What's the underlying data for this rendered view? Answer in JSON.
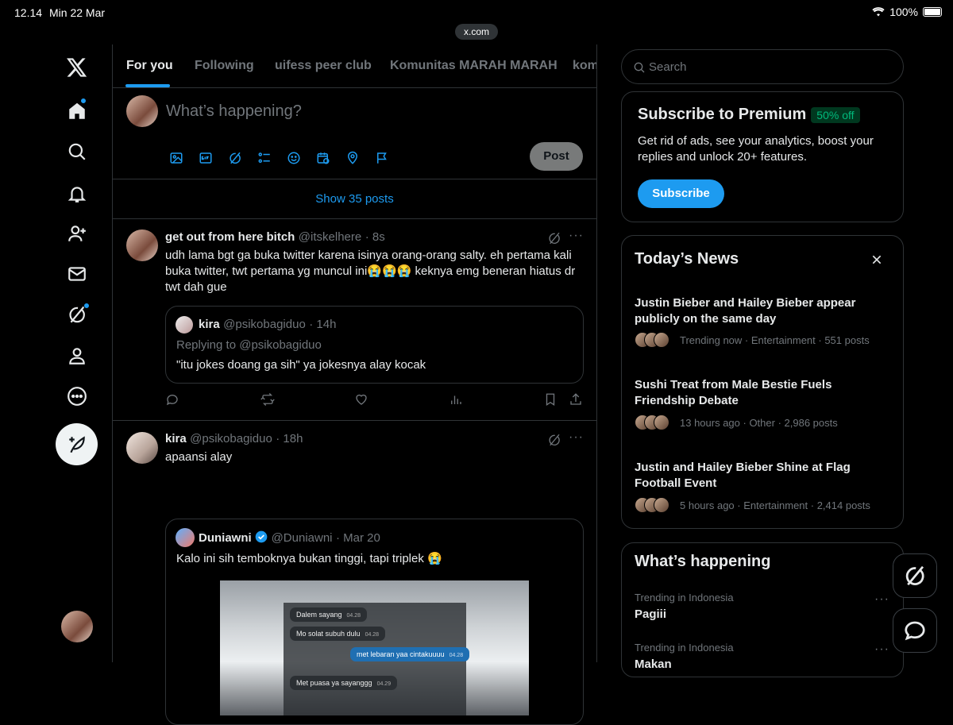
{
  "status_bar": {
    "time": "12.14",
    "date": "Min 22 Mar",
    "battery": "100%"
  },
  "browser": {
    "url": "x.com"
  },
  "tabs": [
    "For you",
    "Following",
    "uifess peer club",
    "Komunitas MARAH MARAH",
    "kom"
  ],
  "composer": {
    "placeholder": "What’s happening?",
    "post_label": "Post"
  },
  "show_posts": "Show 35 posts",
  "tweets": [
    {
      "name": "get out from here bitch",
      "handle": "@itskelhere",
      "time": "· 8s",
      "text": "udh lama bgt ga buka twitter karena isinya orang-orang salty. eh pertama kali buka twitter, twt pertama  yg  muncul ini😭😭😭 keknya  emg  beneran hiatus  dr  twt  dah  gue",
      "quote": {
        "name": "kira",
        "handle": "@psikobagiduo",
        "time": "· 14h",
        "reply_to": "Replying to @psikobagiduo",
        "text": "\"itu jokes doang ga sih\" ya jokesnya alay kocak"
      }
    },
    {
      "name": "kira",
      "handle": "@psikobagiduo",
      "time": "· 18h",
      "text": "apaansi alay",
      "quote": {
        "name": "Duniawni",
        "handle": "@Duniawni",
        "time": "· Mar 20",
        "text": "Kalo ini sih temboknya bukan tinggi, tapi triplek 😭",
        "chat": [
          {
            "text": "Dalem sayang",
            "time": "04.28"
          },
          {
            "text": "Mo solat subuh dulu",
            "time": "04.28"
          },
          {
            "text": "met lebaran yaa cintakuuuu",
            "time": "04.28"
          },
          {
            "text": "Met puasa ya sayanggg",
            "time": "04.29"
          }
        ]
      }
    }
  ],
  "search": {
    "placeholder": "Search"
  },
  "premium": {
    "title": "Subscribe to Premium",
    "badge": "50% off",
    "text": "Get rid of ads, see your analytics, boost your replies and unlock 20+ features.",
    "button": "Subscribe"
  },
  "news": {
    "title": "Today’s News",
    "items": [
      {
        "title": "Justin Bieber and Hailey Bieber appear publicly on the same day",
        "meta": "Trending now · Entertainment · 551 posts"
      },
      {
        "title": "Sushi Treat from Male Bestie Fuels Friendship Debate",
        "meta": "13 hours ago · Other · 2,986 posts"
      },
      {
        "title": "Justin and Hailey Bieber Shine at Flag Football Event",
        "meta": "5 hours ago · Entertainment · 2,414 posts"
      }
    ]
  },
  "happening": {
    "title": "What’s happening",
    "items": [
      {
        "context": "Trending in Indonesia",
        "topic": "Pagiii"
      },
      {
        "context": "Trending in Indonesia",
        "topic": "Makan"
      }
    ]
  },
  "colors": {
    "accent": "#1d9bf0",
    "background": "#000000",
    "border": "#2f3336",
    "muted": "#71767b"
  }
}
